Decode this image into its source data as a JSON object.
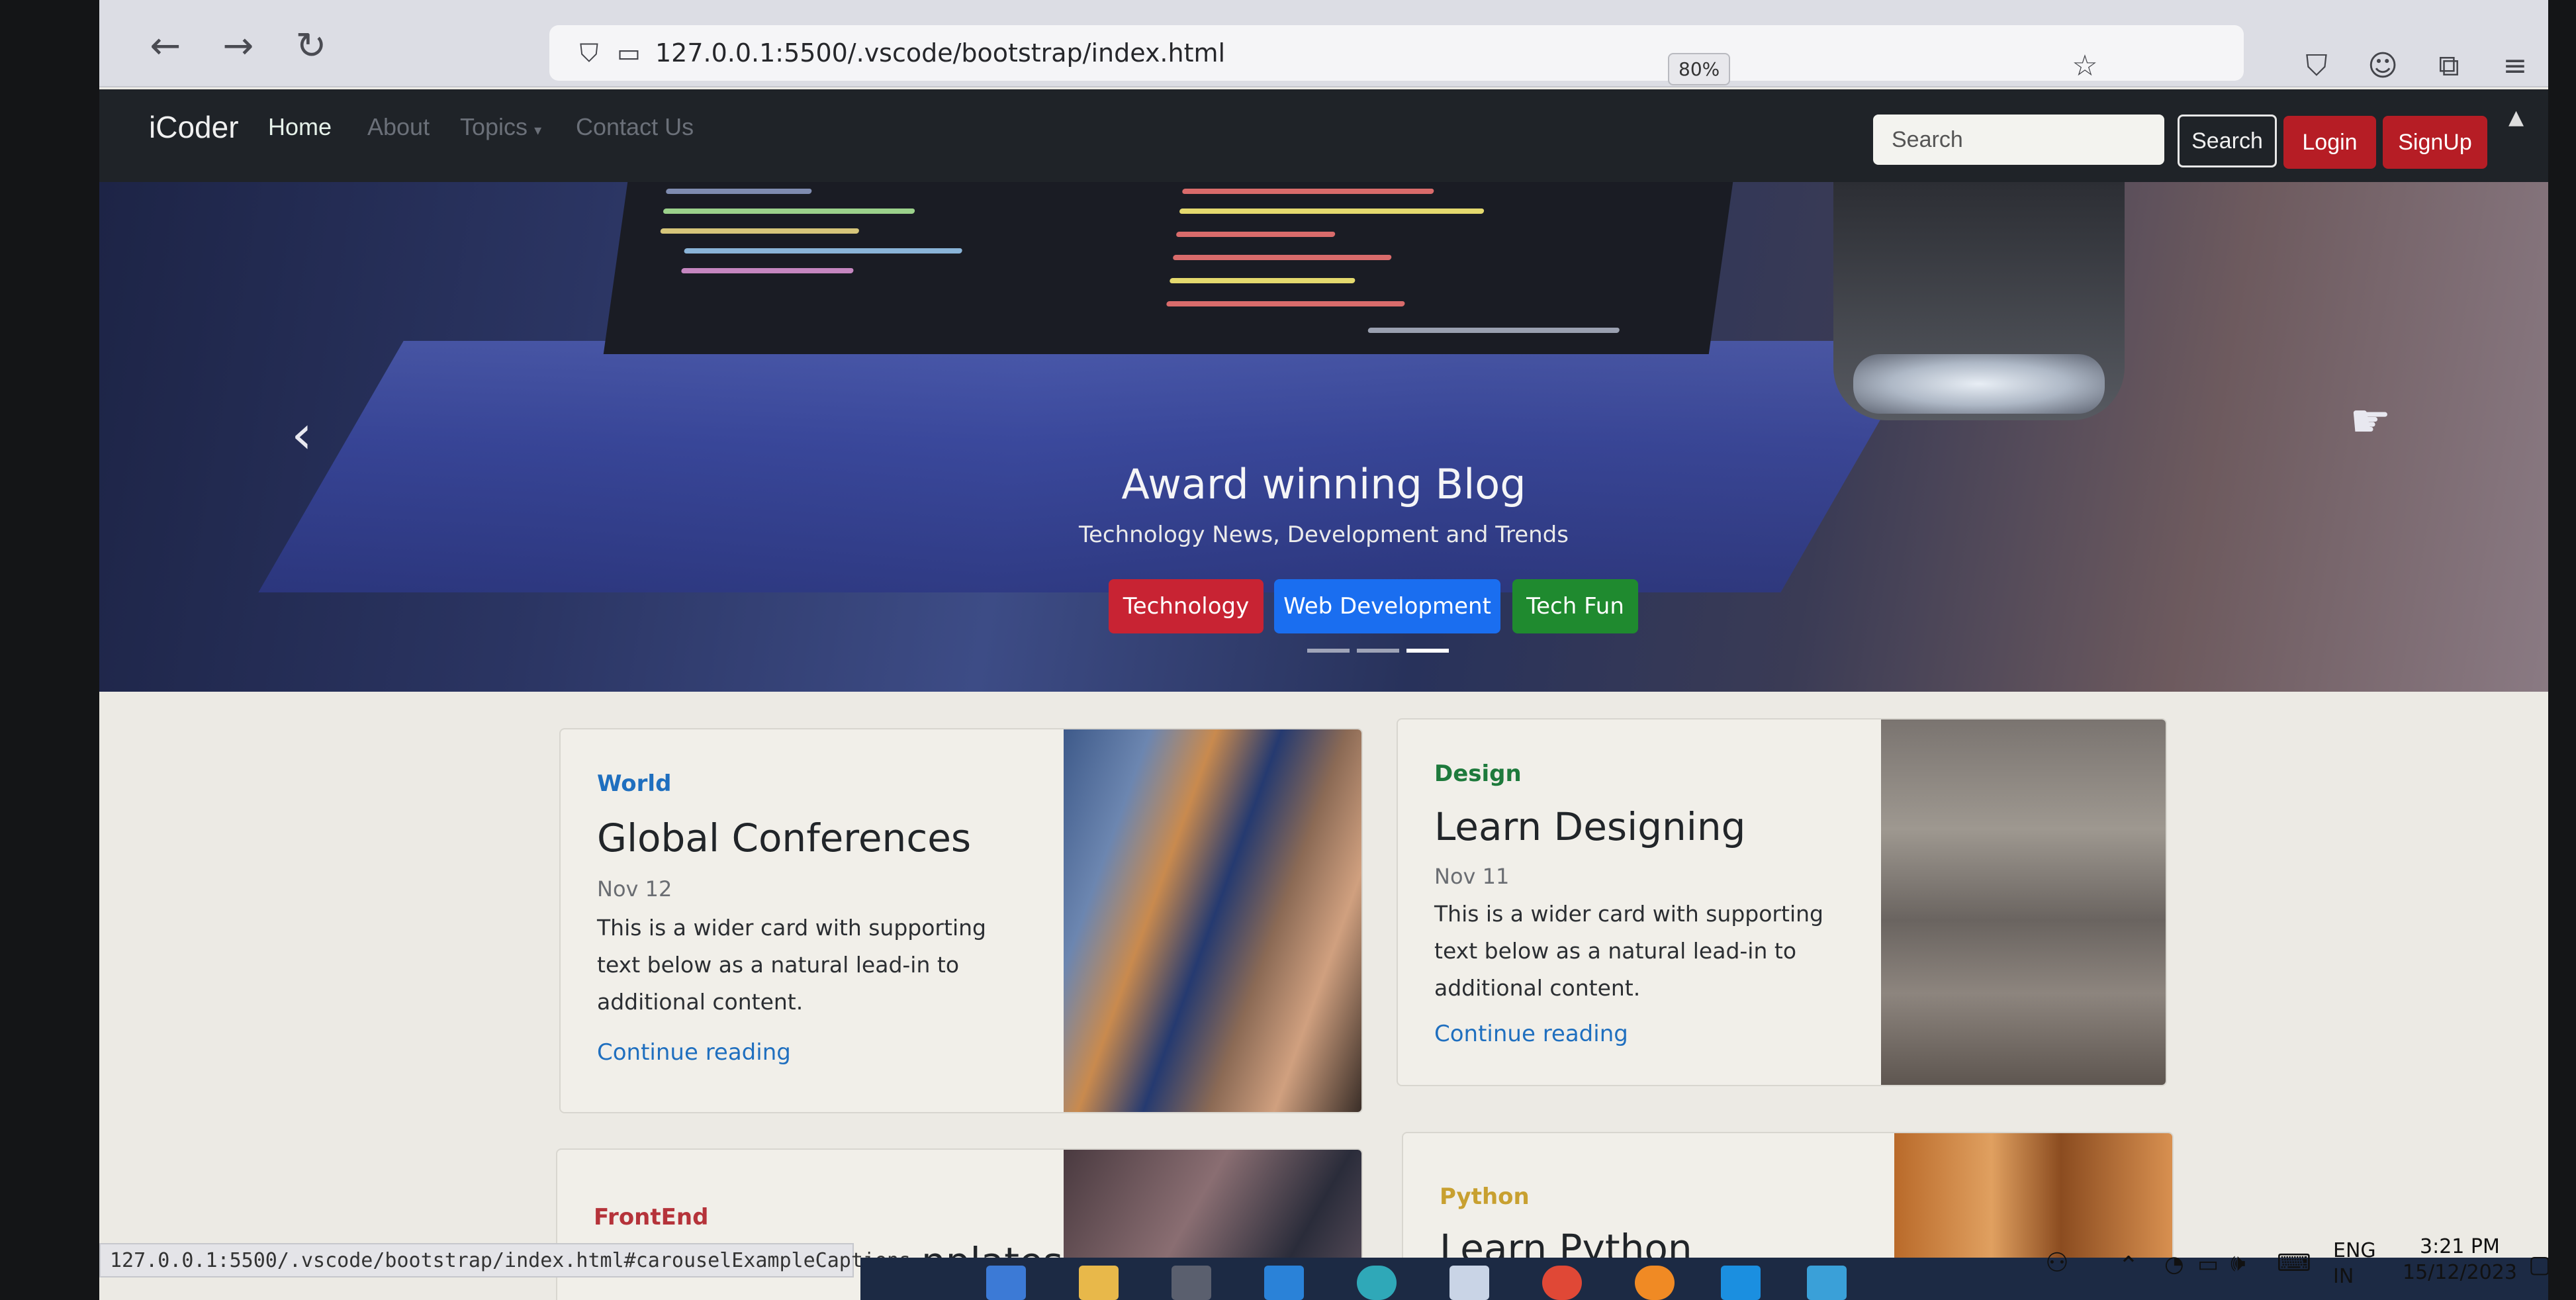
{
  "browser": {
    "url": "127.0.0.1:5500/.vscode/bootstrap/index.html",
    "zoom": "80%",
    "status_url": "127.0.0.1:5500/.vscode/bootstrap/index.html#carouselExampleCaptions"
  },
  "navbar": {
    "brand": "iCoder",
    "links": [
      "Home",
      "About",
      "Topics",
      "Contact Us"
    ],
    "search_placeholder": "Search",
    "search_button": "Search",
    "login": "Login",
    "signup": "SignUp"
  },
  "carousel": {
    "title": "Award winning Blog",
    "subtitle": "Technology News, Development and Trends",
    "buttons": [
      "Technology",
      "Web Development",
      "Tech Fun"
    ],
    "active_slide": 3,
    "slide_count": 3
  },
  "cards": [
    {
      "category": "World",
      "category_color": "#1f6fbf",
      "title": "Global Conferences",
      "date": "Nov 12",
      "text": "This is a wider card with supporting text below as a natural lead-in to additional content.",
      "link": "Continue reading"
    },
    {
      "category": "Design",
      "category_color": "#1e7a3c",
      "title": "Learn Designing",
      "date": "Nov 11",
      "text": "This is a wider card with supporting text below as a natural lead-in to additional content.",
      "link": "Continue reading"
    },
    {
      "category": "FrontEnd",
      "category_color": "#b5333a",
      "title": "Templates",
      "visible_title_fragment": "nplates"
    },
    {
      "category": "Python",
      "category_color": "#c8a030",
      "title": "Learn Python"
    }
  ],
  "taskbar": {
    "lang": "ENG",
    "region": "IN",
    "time": "3:21 PM",
    "date": "15/12/2023"
  }
}
